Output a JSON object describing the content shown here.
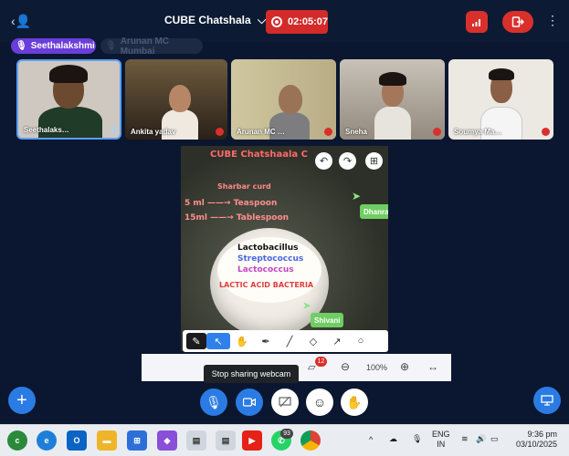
{
  "header": {
    "title": "CUBE Chatshala",
    "recording_time": "02:05:07"
  },
  "speakers": [
    {
      "name": "Seethalakshmi",
      "active": true
    },
    {
      "name": "Arunan MC Mumbai",
      "active": false
    }
  ],
  "participants": [
    {
      "name": "Seethalaks…",
      "muted": false
    },
    {
      "name": "Ankita yadav",
      "muted": true
    },
    {
      "name": "Arunan MC …",
      "muted": true
    },
    {
      "name": "Sneha",
      "muted": true
    },
    {
      "name": "Soumya Ma…",
      "muted": true
    }
  ],
  "shared_content": {
    "heading": "CUBE Chatshaala C",
    "line_sharbat": "Sharbar curd",
    "line_teaspoon": "5 ml ——→ Teaspoon",
    "line_tablespoon": "15ml ——→ Tablespoon",
    "bacteria_1": "Lactobacillus",
    "bacteria_2": "Streptococcus",
    "bacteria_3": "Lactococcus",
    "bacteria_label": "LACTIC ACID BACTERIA",
    "cursor_tag_1": "Dhanra",
    "cursor_tag_2": "Shivani"
  },
  "zoom": {
    "level": "100%",
    "annotation_count": "12",
    "tooltip": "Stop sharing webcam"
  },
  "taskbar": {
    "badge": "93",
    "lang_1": "ENG",
    "lang_2": "IN",
    "time": "9:36 pm",
    "date": "03/10/2025"
  },
  "colors": {
    "background": "#0b1730",
    "accent_blue": "#2b7be4",
    "record_red": "#d32a2a",
    "speaker_chip": "#6a3ed9",
    "cursor_tag_green": "#6fce63"
  }
}
